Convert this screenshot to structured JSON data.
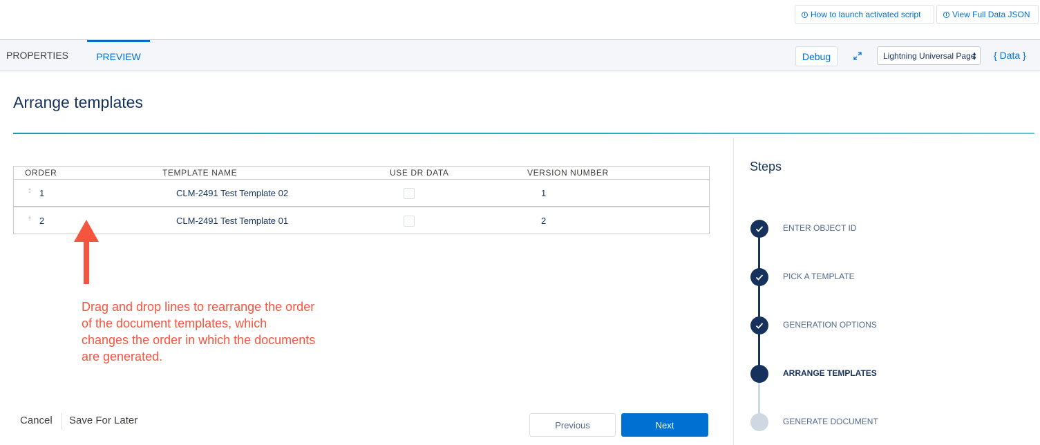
{
  "topbar": {
    "launch_label": "How to launch activated script",
    "json_label": "View Full Data JSON"
  },
  "tabs": {
    "properties": "PROPERTIES",
    "preview": "PREVIEW"
  },
  "toolbar": {
    "debug_label": "Debug",
    "layout_value": "Lightning Universal Page",
    "data_label": "{ Data }"
  },
  "page": {
    "title": "Arrange templates"
  },
  "table": {
    "columns": [
      "ORDER",
      "TEMPLATE NAME",
      "USE DR DATA",
      "VERSION NUMBER"
    ],
    "rows": [
      {
        "order": "1",
        "name": "CLM-2491 Test Template 02",
        "use_dr": false,
        "version": "1"
      },
      {
        "order": "2",
        "name": "CLM-2491 Test Template 01",
        "use_dr": false,
        "version": "2"
      }
    ]
  },
  "annotation": {
    "text": "Drag and drop lines to rearrange the order of the document templates, which changes the order in which the documents are generated."
  },
  "footer": {
    "cancel": "Cancel",
    "save_later": "Save For Later",
    "previous": "Previous",
    "next": "Next"
  },
  "steps": {
    "title": "Steps",
    "items": [
      {
        "label": "ENTER OBJECT ID",
        "state": "done"
      },
      {
        "label": "PICK A TEMPLATE",
        "state": "done"
      },
      {
        "label": "GENERATION OPTIONS",
        "state": "done"
      },
      {
        "label": "ARRANGE TEMPLATES",
        "state": "active"
      },
      {
        "label": "GENERATE DOCUMENT",
        "state": "pending"
      }
    ]
  },
  "colors": {
    "brand": "#0070d2",
    "navy": "#16325c",
    "annotation": "#f5543f",
    "pending": "#cfd7e3"
  }
}
